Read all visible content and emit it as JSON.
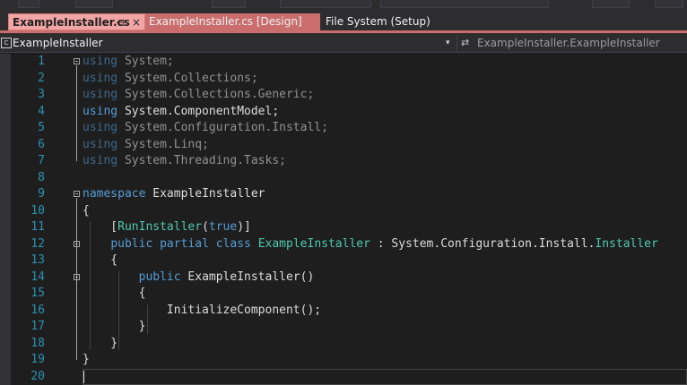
{
  "tabs": [
    {
      "label": "ExampleInstaller.cs",
      "pin": "⊣",
      "close": "×",
      "active": true
    },
    {
      "label": "ExampleInstaller.cs [Design]"
    },
    {
      "label": "File System (Setup)"
    }
  ],
  "nav": {
    "left_icon": "class-icon",
    "left_label": "ExampleInstaller",
    "dropdown_arrow": "▾",
    "right_icon": "member-icon",
    "right_label": "ExampleInstaller.ExampleInstaller"
  },
  "code": {
    "line_numbers": [
      "1",
      "2",
      "3",
      "4",
      "5",
      "6",
      "7",
      "8",
      "9",
      "10",
      "11",
      "12",
      "13",
      "14",
      "15",
      "16",
      "17",
      "18",
      "19",
      "20"
    ],
    "lines": [
      [
        {
          "t": "using",
          "c": "kw"
        },
        {
          "t": " System;",
          "c": ""
        }
      ],
      [
        {
          "t": "using",
          "c": "kw"
        },
        {
          "t": " System.Collections;",
          "c": ""
        }
      ],
      [
        {
          "t": "using",
          "c": "kw"
        },
        {
          "t": " System.Collections.Generic;",
          "c": ""
        }
      ],
      [
        {
          "t": "using",
          "c": "kw"
        },
        {
          "t": " System.ComponentModel;",
          "c": ""
        }
      ],
      [
        {
          "t": "using",
          "c": "kw"
        },
        {
          "t": " System.Configuration.Install;",
          "c": ""
        }
      ],
      [
        {
          "t": "using",
          "c": "kw"
        },
        {
          "t": " System.Linq;",
          "c": ""
        }
      ],
      [
        {
          "t": "using",
          "c": "kw"
        },
        {
          "t": " System.Threading.Tasks;",
          "c": ""
        }
      ],
      [],
      [
        {
          "t": "namespace",
          "c": "kw"
        },
        {
          "t": " ExampleInstaller",
          "c": ""
        }
      ],
      [
        {
          "t": "{",
          "c": ""
        }
      ],
      [
        {
          "t": "    [",
          "c": ""
        },
        {
          "t": "RunInstaller",
          "c": "ty"
        },
        {
          "t": "(",
          "c": ""
        },
        {
          "t": "true",
          "c": "kw"
        },
        {
          "t": ")]",
          "c": ""
        }
      ],
      [
        {
          "t": "    ",
          "c": ""
        },
        {
          "t": "public",
          "c": "kw"
        },
        {
          "t": " ",
          "c": ""
        },
        {
          "t": "partial",
          "c": "kw"
        },
        {
          "t": " ",
          "c": ""
        },
        {
          "t": "class",
          "c": "kw"
        },
        {
          "t": " ",
          "c": ""
        },
        {
          "t": "ExampleInstaller",
          "c": "ty"
        },
        {
          "t": " : System.Configuration.Install.",
          "c": ""
        },
        {
          "t": "Installer",
          "c": "ty"
        }
      ],
      [
        {
          "t": "    {",
          "c": ""
        }
      ],
      [
        {
          "t": "        ",
          "c": ""
        },
        {
          "t": "public",
          "c": "kw"
        },
        {
          "t": " ExampleInstaller()",
          "c": ""
        }
      ],
      [
        {
          "t": "        {",
          "c": ""
        }
      ],
      [
        {
          "t": "            InitializeComponent();",
          "c": ""
        }
      ],
      [
        {
          "t": "        }",
          "c": ""
        }
      ],
      [
        {
          "t": "    }",
          "c": ""
        }
      ],
      [
        {
          "t": "}",
          "c": ""
        }
      ],
      []
    ]
  },
  "colors": {
    "keyword": "#569cd6",
    "type": "#4ec9b0",
    "line_number": "#2b91af",
    "active_tab": "#f2a5a5",
    "tab_accent": "#c96d6d"
  }
}
